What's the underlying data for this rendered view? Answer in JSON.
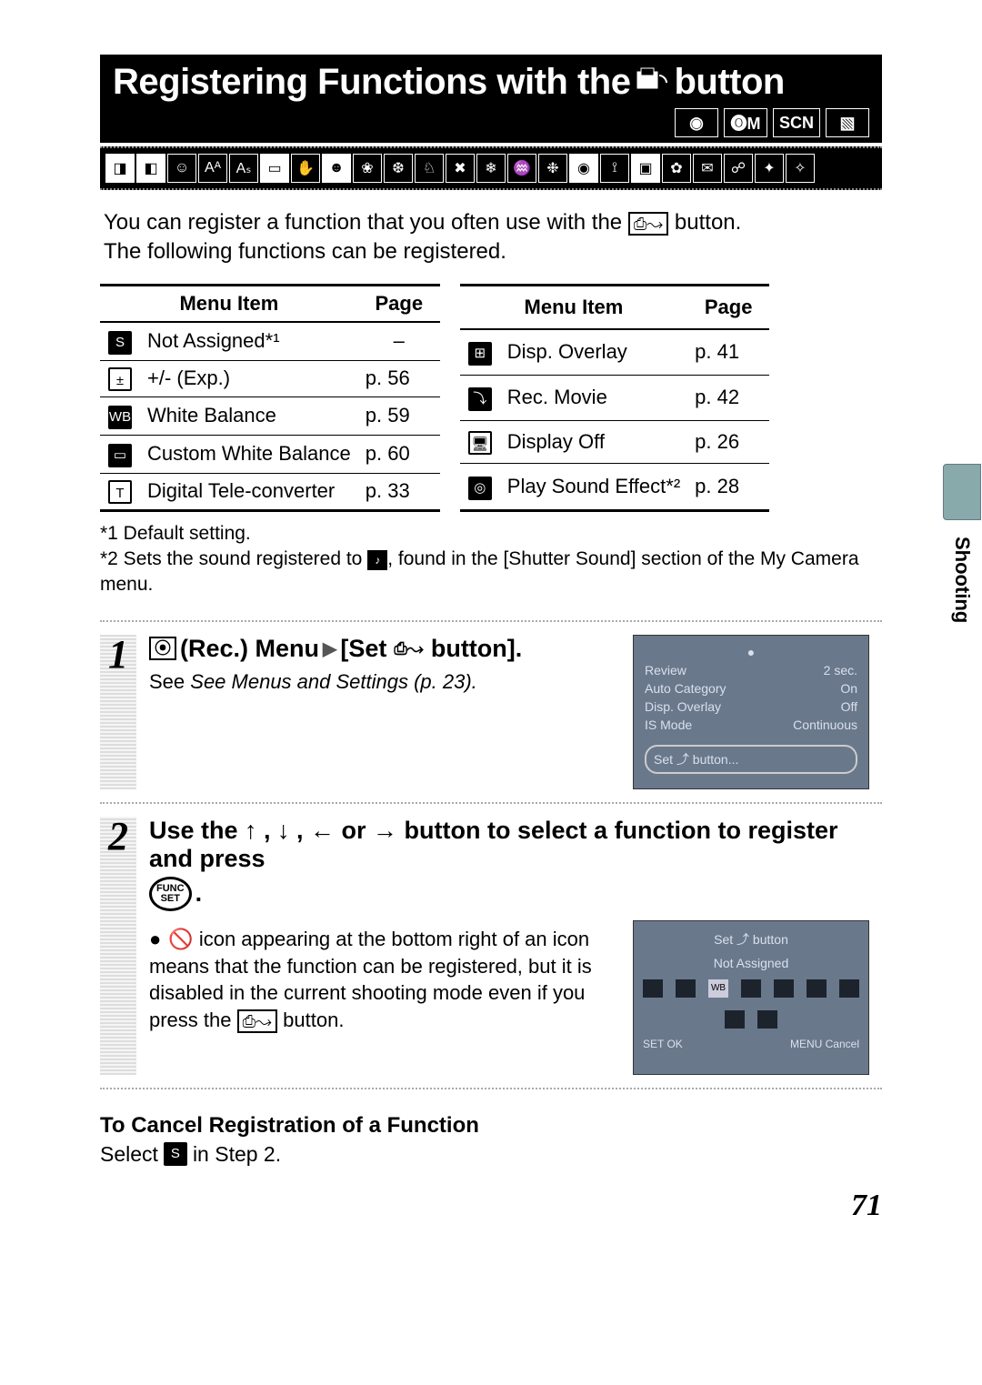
{
  "header": {
    "title_pre": "Registering Functions with the",
    "title_post": "button",
    "modes": [
      "📷",
      "🅞M",
      "SCN",
      "🎬"
    ]
  },
  "icon_strip_count": 24,
  "intro": {
    "line1_pre": "You can register a function that you often use with the",
    "line1_post": "button.",
    "line2": "The following functions can be registered."
  },
  "tables": {
    "headers": {
      "menu_item": "Menu Item",
      "page": "Page"
    },
    "left": [
      {
        "icon": "S",
        "item": "Not Assigned*¹",
        "page": "–"
      },
      {
        "icon": "±",
        "item": "+/- (Exp.)",
        "page": "p. 56"
      },
      {
        "icon": "WB",
        "item": "White Balance",
        "page": "p. 59"
      },
      {
        "icon": "▭",
        "item": "Custom White Balance",
        "page": "p. 60"
      },
      {
        "icon": "T",
        "item": "Digital Tele-converter",
        "page": "p. 33"
      }
    ],
    "right": [
      {
        "icon": "⊞",
        "item": "Disp. Overlay",
        "page": "p. 41"
      },
      {
        "icon": "⤵",
        "item": "Rec. Movie",
        "page": "p. 42"
      },
      {
        "icon": "🖥",
        "item": "Display Off",
        "page": "p. 26"
      },
      {
        "icon": "◎",
        "item": "Play Sound Effect*²",
        "page": "p. 28"
      }
    ]
  },
  "footnotes": {
    "f1": "*1 Default setting.",
    "f2_pre": "*2 Sets the sound registered to",
    "f2_post": ", found in the [Shutter Sound] section of the My Camera menu."
  },
  "side_tab": "Shooting",
  "steps": {
    "s1": {
      "num": "1",
      "title_pre": "(Rec.) Menu",
      "title_mid": "[Set",
      "title_post": "button].",
      "sub": "See Menus and Settings (p. 23).",
      "mock": {
        "rows": [
          [
            "Review",
            "2 sec."
          ],
          [
            "Auto Category",
            "On"
          ],
          [
            "Disp. Overlay",
            "Off"
          ],
          [
            "IS Mode",
            "Continuous"
          ]
        ],
        "highlight": "Set ⤴ button..."
      }
    },
    "s2": {
      "num": "2",
      "title": "Use the  ↑ ,  ↓ ,  ←  or  →  button to select a function to register and press",
      "note_pre": "icon appearing at the bottom right of an icon means that the function can be registered, but it is disabled in the current shooting mode even if you press the",
      "note_post": "button.",
      "mock": {
        "title": "Set ⤴ button",
        "sub": "Not Assigned",
        "footer_left": "SET OK",
        "footer_right": "MENU Cancel"
      }
    }
  },
  "cancel": {
    "title": "To Cancel Registration of a Function",
    "pre": "Select",
    "post": "in Step 2."
  },
  "page_number": "71"
}
